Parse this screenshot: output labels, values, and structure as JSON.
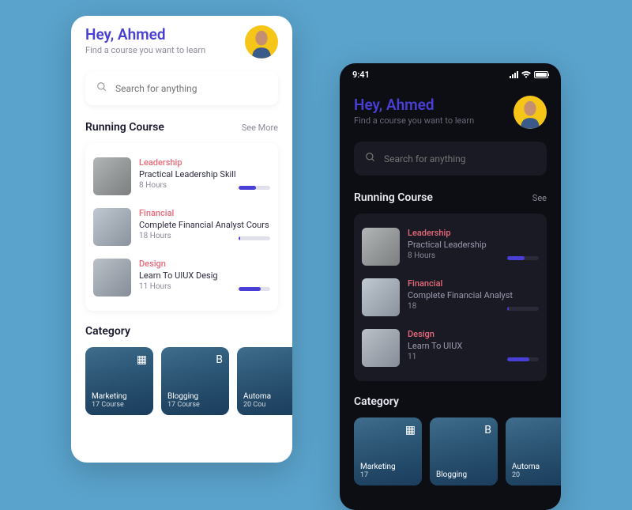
{
  "status": {
    "time": "9:41"
  },
  "header": {
    "greeting": "Hey, Ahmed",
    "subtitle": "Find a course you want to learn"
  },
  "search": {
    "placeholder": "Search for anything"
  },
  "running": {
    "light_title": "Running Course",
    "dark_title": "Running Course",
    "light_see": "See More",
    "dark_see": "See",
    "light_items": [
      {
        "tag": "Leadership",
        "name": "Practical Leadership Skill",
        "hours": "8 Hours",
        "progress": 55
      },
      {
        "tag": "Financial",
        "name": "Complete Financial Analyst Cours",
        "hours": "18 Hours",
        "progress": 5
      },
      {
        "tag": "Design",
        "name": "Learn To UIUX Desig",
        "hours": "11 Hours",
        "progress": 70
      }
    ],
    "dark_items": [
      {
        "tag": "Leadership",
        "name": "Practical Leadership",
        "hours": "8 Hours",
        "progress": 55
      },
      {
        "tag": "Financial",
        "name": "Complete Financial Analyst",
        "hours": "18",
        "progress": 5
      },
      {
        "tag": "Design",
        "name": "Learn To UIUX",
        "hours": "11",
        "progress": 70
      }
    ]
  },
  "category": {
    "title": "Category",
    "items": [
      {
        "name": "Marketing",
        "count": "17 Course"
      },
      {
        "name": "Blogging",
        "count": "17 Course"
      },
      {
        "name": "Automa",
        "count": "20 Cou"
      }
    ],
    "dark_items": [
      {
        "name": "Marketing",
        "count": "17"
      },
      {
        "name": "Blogging",
        "count": ""
      },
      {
        "name": "Automa",
        "count": "20"
      }
    ]
  },
  "colors": {
    "accent": "#4a3fd4",
    "tag": "#e76a7a"
  }
}
